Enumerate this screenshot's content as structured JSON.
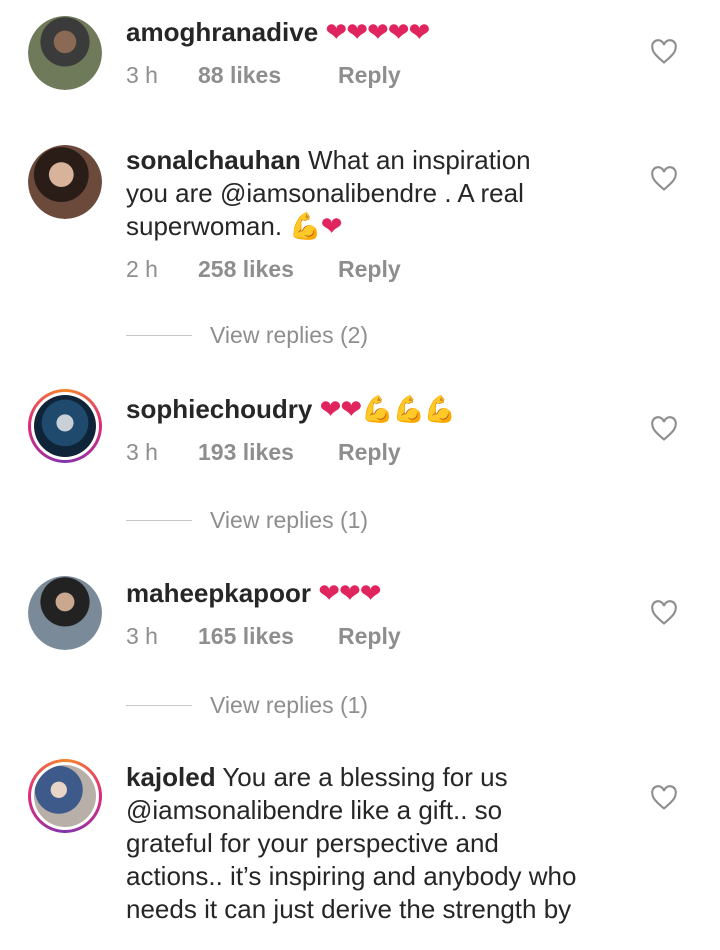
{
  "comments": [
    {
      "username": "amoghranadive",
      "text": "",
      "emoji": "❤❤❤❤❤",
      "time": "3 h",
      "likes": "88 likes",
      "reply": "Reply"
    },
    {
      "username": "sonalchauhan",
      "text_line1": " What an inspiration",
      "text_line2_pre": "you are ",
      "mention": "@iamsonalibendre",
      "text_line2_post": " . A real",
      "text_line3": "superwoman. ",
      "emoji_arm": "💪",
      "emoji_heart": "❤",
      "time": "2 h",
      "likes": "258 likes",
      "reply": "Reply",
      "view_replies": "View replies (2)"
    },
    {
      "username": "sophiechoudry",
      "emoji_hearts": "❤❤",
      "emoji_arms": "💪💪💪",
      "time": "3 h",
      "likes": "193 likes",
      "reply": "Reply",
      "view_replies": "View replies (1)"
    },
    {
      "username": "maheepkapoor",
      "emoji": "❤❤❤",
      "time": "3 h",
      "likes": "165 likes",
      "reply": "Reply",
      "view_replies": "View replies (1)"
    },
    {
      "username": "kajoled",
      "text_line1": " You are a blessing for us",
      "mention": "@iamsonalibendre",
      "text_line2_post": " like a gift.. so",
      "text_line3": "grateful for your perspective and",
      "text_line4": "actions.. it’s inspiring and anybody who",
      "text_line5": "needs it can just derive the strength by"
    }
  ],
  "colors": {
    "text": "#262626",
    "secondary": "#8e8e8e",
    "heart_emoji": "#e0245e"
  },
  "icons": {
    "like": "heart-outline-icon"
  }
}
